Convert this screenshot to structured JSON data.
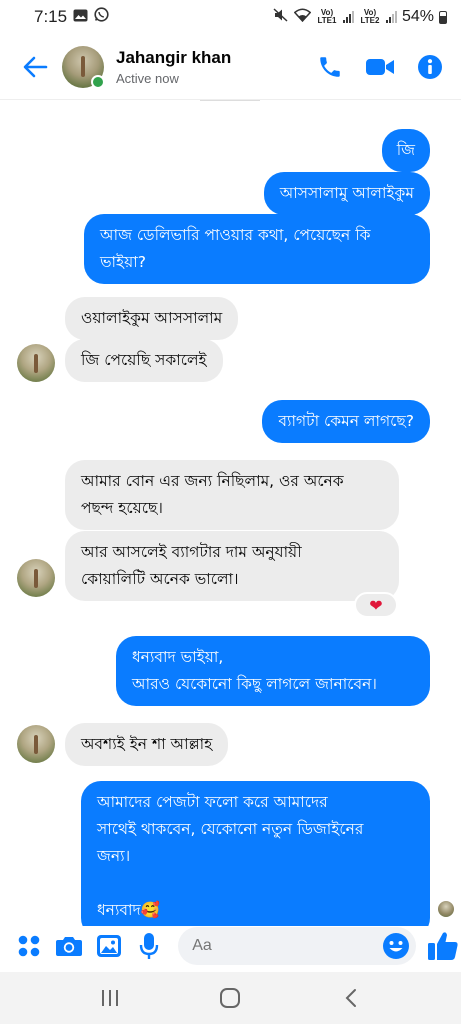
{
  "status_bar": {
    "time": "7:15",
    "sim1": "Vo) LTE1",
    "sim2": "Vo) LTE2",
    "battery": "54%"
  },
  "header": {
    "contact_name": "Jahangir khan",
    "contact_status": "Active now"
  },
  "messages": [
    {
      "side": "out",
      "text": "জি"
    },
    {
      "side": "out",
      "text": "আসসালামু আলাইকুম"
    },
    {
      "side": "out",
      "text": "আজ ডেলিভারি পাওয়ার কথা, পেয়েছেন কি\nভাইয়া?"
    },
    {
      "side": "in",
      "text": "ওয়ালাইকুম আসসালাম"
    },
    {
      "side": "in",
      "text": "জি পেয়েছি সকালেই"
    },
    {
      "side": "out",
      "text": "ব্যাগটা কেমন লাগছে?"
    },
    {
      "side": "in",
      "text": "আমার বোন এর জন্য নিছিলাম, ওর অনেক\nপছন্দ হয়েছে।"
    },
    {
      "side": "in",
      "text": "আর আসলেই ব্যাগটার দাম অনুযায়ী\nকোয়ালিটি অনেক ভালো।",
      "reaction": "❤"
    },
    {
      "side": "out",
      "text": "ধন্যবাদ ভাইয়া,\nআরও যেকোনো কিছু লাগলে জানাবেন।"
    },
    {
      "side": "in",
      "text": "অবশ্যই ইন শা আল্লাহ"
    },
    {
      "side": "out",
      "text": "আমাদের পেজটা ফলো করে আমাদের\nসাথেই থাকবেন, যেকোনো নতুন ডিজাইনের\nজন্য।\n\nধন্যবাদ🥰"
    }
  ],
  "composer": {
    "placeholder": "Aa"
  },
  "colors": {
    "accent": "#0a7cff",
    "incoming_bubble": "#ececec",
    "online": "#31a24c"
  },
  "icons": [
    "back-arrow-icon",
    "phone-icon",
    "video-icon",
    "info-icon",
    "apps-icon",
    "camera-icon",
    "image-icon",
    "mic-icon",
    "emoji-icon",
    "thumbs-up-icon",
    "recents-icon",
    "home-icon",
    "back-icon"
  ]
}
